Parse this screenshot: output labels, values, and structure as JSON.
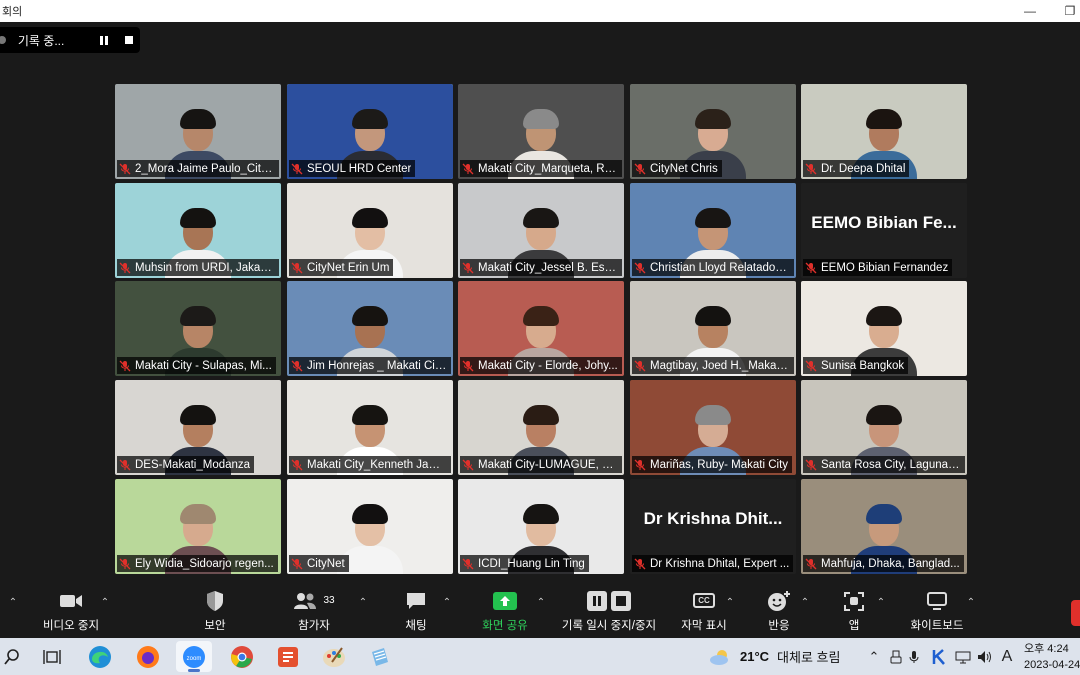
{
  "window": {
    "title": "회의",
    "recording_label": "기록 중..."
  },
  "tiles": [
    {
      "name": "2_Mora Jaime Paulo_City...",
      "bg": "#9fa6a8",
      "skin": "#b6876a",
      "hair": "#161412",
      "shirt": "#3d4a63"
    },
    {
      "name": "SEOUL HRD Center",
      "bg": "#2c4f9e",
      "skin": "#c3977c",
      "hair": "#1c1a18",
      "shirt": "#2a2c33"
    },
    {
      "name": "Makati City_Marqueta, Rh...",
      "bg": "#4f4f4f",
      "skin": "#bf9474",
      "hair": "#8a8a8a",
      "shirt": "#e9e6e1"
    },
    {
      "name": "CityNet Chris",
      "bg": "#6a6e68",
      "skin": "#d8ab92",
      "hair": "#2b2119",
      "shirt": "#3a3f4a"
    },
    {
      "name": "Dr. Deepa Dhital",
      "bg": "#c9cbc0",
      "skin": "#b07b5e",
      "hair": "#1b1410",
      "shirt": "#3b6c9a"
    },
    {
      "name": "Muhsin from URDI, Jakart...",
      "bg": "#9dd3d8",
      "skin": "#a87555",
      "hair": "#141210",
      "shirt": "#f1f1f1"
    },
    {
      "name": "CityNet Erin Um",
      "bg": "#e5e2dd",
      "skin": "#e3bea4",
      "hair": "#121010",
      "shirt": "#f5f5f5"
    },
    {
      "name": "Makati City_Jessel B. Esca...",
      "bg": "#c8c9cb",
      "skin": "#d6a98b",
      "hair": "#191614",
      "shirt": "#3b3b3d"
    },
    {
      "name": "Christian Lloyd Relatado_...",
      "bg": "#5f84b3",
      "skin": "#c59576",
      "hair": "#181513",
      "shirt": "#ededed"
    },
    {
      "name": "EEMO Bibian Fernandez",
      "bg": "#1f1f1f",
      "text": "EEMO Bibian Fe..."
    },
    {
      "name": "Makati City - Sulapas, Mi...",
      "bg": "#43513f",
      "skin": "#b78566",
      "hair": "#1c1a18",
      "shirt": "#2d3b2f"
    },
    {
      "name": "Jim Honrejas _ Makati Cit...",
      "bg": "#6a8cb7",
      "skin": "#a87252",
      "hair": "#161310",
      "shirt": "#cfd4d8"
    },
    {
      "name": "Makati City - Elorde, Johy...",
      "bg": "#b85c52",
      "skin": "#d7ab8e",
      "hair": "#3a2216",
      "shirt": "#b9a6a0"
    },
    {
      "name": "Magtibay, Joed H._Makati...",
      "bg": "#c9c6bf",
      "skin": "#b78261",
      "hair": "#141210",
      "shirt": "#f3f3f3"
    },
    {
      "name": "Sunisa Bangkok",
      "bg": "#ece8e2",
      "skin": "#d9ad90",
      "hair": "#1b1613",
      "shirt": "#3c3c3c"
    },
    {
      "name": "DES-Makati_Modanza",
      "bg": "#d8d6d2",
      "skin": "#b47f5f",
      "hair": "#141210",
      "shirt": "#2e3442"
    },
    {
      "name": "Makati City_Kenneth Jam...",
      "bg": "#e6e4e0",
      "skin": "#c69373",
      "hair": "#161411",
      "shirt": "#ffffff"
    },
    {
      "name": "Makati City-LUMAGUE, R...",
      "bg": "#d8d6d0",
      "skin": "#b98063",
      "hair": "#2a1c14",
      "shirt": "#4a4f5a"
    },
    {
      "name": "Mariñas, Ruby- Makati City",
      "bg": "#8f4a36",
      "skin": "#d5ac94",
      "hair": "#8a8a8a",
      "shirt": "#6e8cb7"
    },
    {
      "name": "Santa Rosa City, Laguna, ...",
      "bg": "#c8c5bc",
      "skin": "#c8957a",
      "hair": "#1a1512",
      "shirt": "#5d6170"
    },
    {
      "name": "Ely Widia_Sidoarjo regen...",
      "bg": "#b9d89a",
      "skin": "#d6aa8e",
      "hair": "#9f8870",
      "shirt": "#6d4f52"
    },
    {
      "name": "CityNet",
      "bg": "#efeeec",
      "skin": "#e4c0a6",
      "hair": "#121010",
      "shirt": "#f4f4f4"
    },
    {
      "name": "ICDI_Huang Lin Ting",
      "bg": "#e9e9e9",
      "skin": "#e1bba0",
      "hair": "#161412",
      "shirt": "#2f2f32"
    },
    {
      "name": "Dr Krishna Dhital, Expert ...",
      "bg": "#1f1f1f",
      "text": "Dr Krishna Dhit..."
    },
    {
      "name": "Mahfuja, Dhaka, Banglad...",
      "bg": "#9a8e7c",
      "skin": "#c79a7c",
      "hair": "#1e3e78",
      "shirt": "#1f3d7a"
    }
  ],
  "toolbar": {
    "items": [
      {
        "label": "비디오 중지",
        "icon": "video-camera-icon"
      },
      {
        "label": "보안",
        "icon": "shield-icon"
      },
      {
        "label": "참가자",
        "icon": "participants-icon",
        "count": "33"
      },
      {
        "label": "채팅",
        "icon": "chat-bubble-icon"
      },
      {
        "label": "화면 공유",
        "icon": "share-screen-icon"
      },
      {
        "label": "기록 일시 중지/중지",
        "icon": "record-pause-stop-icon"
      },
      {
        "label": "자막 표시",
        "icon": "cc-icon",
        "cc_text": "CC"
      },
      {
        "label": "반응",
        "icon": "smiley-plus-icon"
      },
      {
        "label": "앱",
        "icon": "apps-icon"
      },
      {
        "label": "화이트보드",
        "icon": "whiteboard-icon"
      }
    ]
  },
  "taskbar": {
    "weather_temp": "21°C",
    "weather_desc": "대체로 흐림",
    "time": "오후 4:24",
    "date": "2023-04-24",
    "ime": "A"
  },
  "colors": {
    "active_speaker_border": "#e8ef5a",
    "share_green": "#23c14f",
    "muted_red": "#e0302b"
  }
}
